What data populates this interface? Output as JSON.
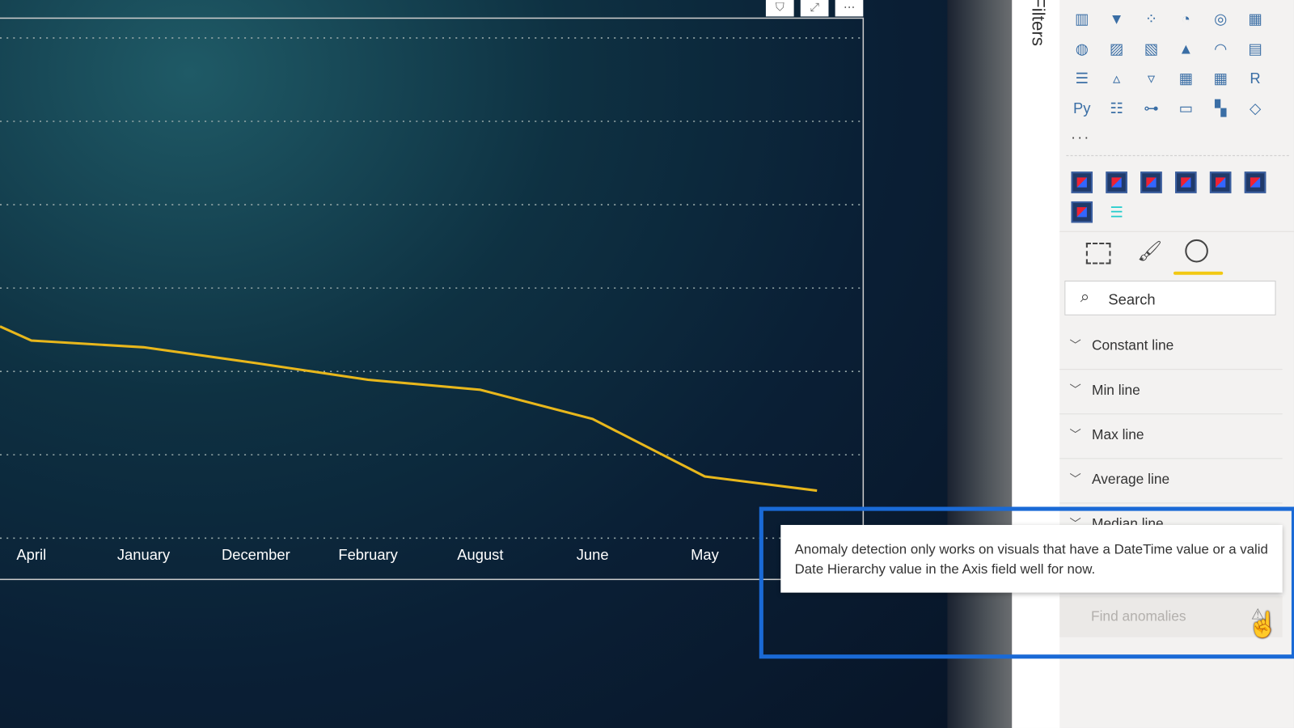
{
  "filters_pane": {
    "label": "Filters"
  },
  "visual_header": {
    "icons": [
      "filter-icon",
      "focus-mode-icon",
      "more-options-icon"
    ]
  },
  "chart_data": {
    "type": "line",
    "categories": [
      "April",
      "January",
      "December",
      "February",
      "August",
      "June",
      "May",
      ""
    ],
    "values": [
      2.37,
      2.29,
      2.1,
      1.9,
      1.78,
      1.43,
      0.74,
      0.57
    ],
    "line_color": "#e8b71c",
    "grid": "horizontal dotted",
    "xlabel": "",
    "ylabel": "",
    "title": ""
  },
  "visualizations": {
    "more_label": "...",
    "tabs": [
      {
        "name": "fields-icon"
      },
      {
        "name": "format-icon"
      },
      {
        "name": "analytics-icon",
        "active": true
      }
    ],
    "search_placeholder": "Search",
    "sections": [
      "Constant line",
      "Min line",
      "Max line",
      "Average line",
      "Median line"
    ],
    "find_anomalies": "Find anomalies"
  },
  "tooltip": {
    "text": "Anomaly detection only works on visuals that have a DateTime value or a valid Date Hierarchy value in the Axis field well for now."
  },
  "colors": {
    "accent": "#f2c811",
    "highlight": "#1a6ad6"
  }
}
